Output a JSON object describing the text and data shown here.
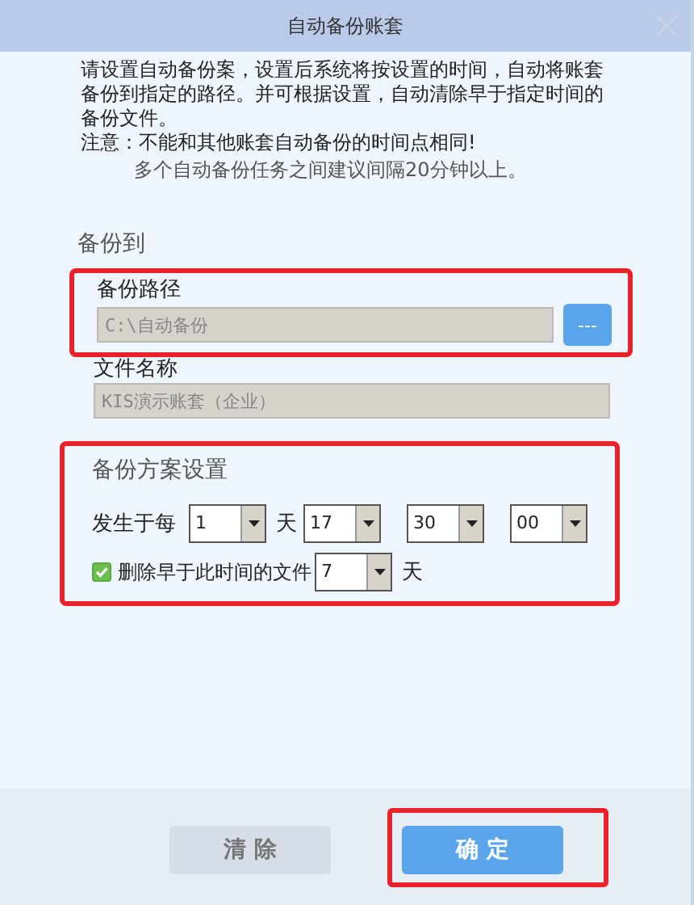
{
  "window": {
    "title": "自动备份账套"
  },
  "intro": {
    "text": "请设置自动备份案，设置后系统将按设置的时间，自动将账套备份到指定的路径。并可根据设置，自动清除早于指定时间的备份文件。",
    "note": "注意：不能和其他账套自动备份的时间点相同!",
    "tip": "多个自动备份任务之间建议间隔20分钟以上。"
  },
  "backup_to": {
    "heading": "备份到",
    "path": {
      "label": "备份路径",
      "value": "C:\\自动备份",
      "browse": "---",
      "highlighted": true
    },
    "file_name": {
      "label": "文件名称",
      "value": "KIS演示账套（企业）"
    }
  },
  "schedule": {
    "heading": "备份方案设置",
    "highlighted": true,
    "occurs_label": "发生于每",
    "selects": [
      {
        "value": "1",
        "unit": "天"
      },
      {
        "value": "17"
      },
      {
        "value": "30"
      },
      {
        "value": "00"
      }
    ],
    "cleanup": {
      "checked": true,
      "label": "删除早于此时间的文件",
      "days": "7",
      "unit": "天"
    }
  },
  "buttons": [
    {
      "label": "清 除",
      "kind": "secondary",
      "highlighted": false
    },
    {
      "label": "确 定",
      "kind": "primary",
      "highlighted": true
    }
  ]
}
